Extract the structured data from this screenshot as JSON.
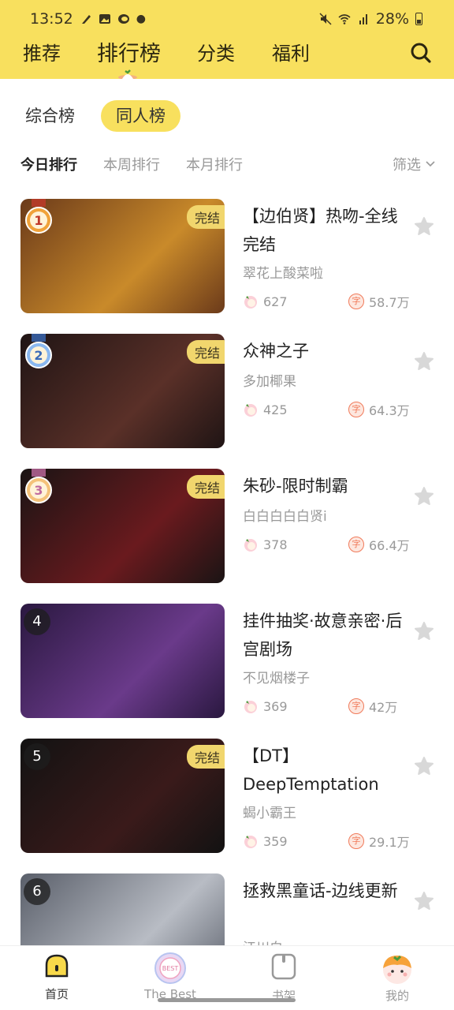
{
  "status_bar": {
    "time": "13:52",
    "battery": "28%"
  },
  "nav": {
    "tabs": [
      {
        "label": "推荐"
      },
      {
        "label": "排行榜",
        "active": true
      },
      {
        "label": "分类"
      },
      {
        "label": "福利"
      }
    ],
    "search_icon": "search-icon"
  },
  "segment": {
    "options": [
      {
        "label": "综合榜"
      },
      {
        "label": "同人榜",
        "active": true
      }
    ]
  },
  "period": {
    "options": [
      {
        "label": "今日排行",
        "active": true
      },
      {
        "label": "本周排行"
      },
      {
        "label": "本月排行"
      }
    ],
    "filter_label": "筛选"
  },
  "completed_label": "完结",
  "books": [
    {
      "rank": "1",
      "title": "【边伯贤】热吻-全线完结",
      "author": "翠花上酸菜啦",
      "likes": "627",
      "words": "58.7万",
      "completed": true,
      "cover_colors": [
        "#6b3a1a",
        "#c98a2a"
      ]
    },
    {
      "rank": "2",
      "title": "众神之子",
      "author": "多加椰果",
      "likes": "425",
      "words": "64.3万",
      "completed": true,
      "cover_colors": [
        "#1f1414",
        "#5a3028"
      ]
    },
    {
      "rank": "3",
      "title": "朱砂-限时制霸",
      "author": "白白白白白贤i",
      "likes": "378",
      "words": "66.4万",
      "completed": true,
      "cover_colors": [
        "#1a1414",
        "#6a1a1e"
      ]
    },
    {
      "rank": "4",
      "title": "挂件抽奖·故意亲密·后宫剧场",
      "author": "不见烟楼子",
      "likes": "369",
      "words": "42万",
      "completed": false,
      "cover_colors": [
        "#2a1840",
        "#6a3a8a"
      ]
    },
    {
      "rank": "5",
      "title": "【DT】DeepTemptation",
      "author": "蝎小霸王",
      "likes": "359",
      "words": "29.1万",
      "completed": true,
      "cover_colors": [
        "#121212",
        "#3a1a1a"
      ]
    },
    {
      "rank": "6",
      "title": "拯救黑童话-边线更新",
      "author": "江川白一",
      "likes": "",
      "words": "",
      "completed": false,
      "cover_colors": [
        "#5a5f6a",
        "#b8bcc4"
      ]
    }
  ],
  "tabbar": {
    "items": [
      {
        "label": "首页",
        "active": true
      },
      {
        "label": "The Best"
      },
      {
        "label": "书架"
      },
      {
        "label": "我的"
      }
    ]
  }
}
